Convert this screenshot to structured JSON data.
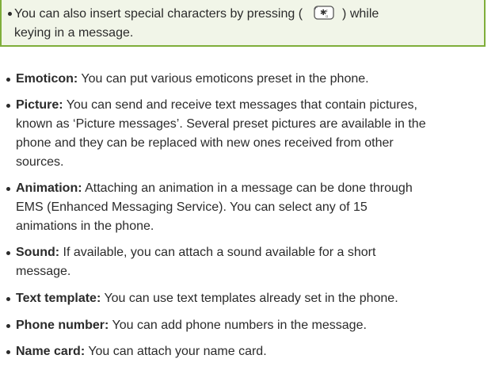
{
  "note": {
    "line1_before": "You can also insert special characters by pressing (",
    "line1_after": ") while",
    "line2": "keying in a message.",
    "key_icon": "star-key-icon"
  },
  "items": [
    {
      "term": "Emoticon:",
      "lines": [
        " You can put various emoticons preset in the phone."
      ]
    },
    {
      "term": "Picture:",
      "lines": [
        " You can send and receive text messages that contain pictures,",
        "known as ‘Picture messages’. Several preset pictures are available in the",
        "phone and they can be replaced with new ones received from other",
        "sources."
      ]
    },
    {
      "term": "Animation:",
      "lines": [
        " Attaching an animation in a message can be done through",
        "EMS (Enhanced Messaging Service). You can select any of 15",
        "animations in the phone."
      ]
    },
    {
      "term": "Sound:",
      "lines": [
        " If available, you can attach a sound available for a short",
        "message."
      ]
    },
    {
      "term": "Text template:",
      "lines": [
        " You can use text templates already set in the phone."
      ]
    },
    {
      "term": "Phone number:",
      "lines": [
        " You can add phone numbers in the message."
      ]
    },
    {
      "term": "Name card:",
      "lines": [
        " You can attach your name card."
      ]
    }
  ],
  "colors": {
    "note_border": "#7fae3a",
    "note_background": "#f1f5e8",
    "text": "#2b2b2b"
  }
}
